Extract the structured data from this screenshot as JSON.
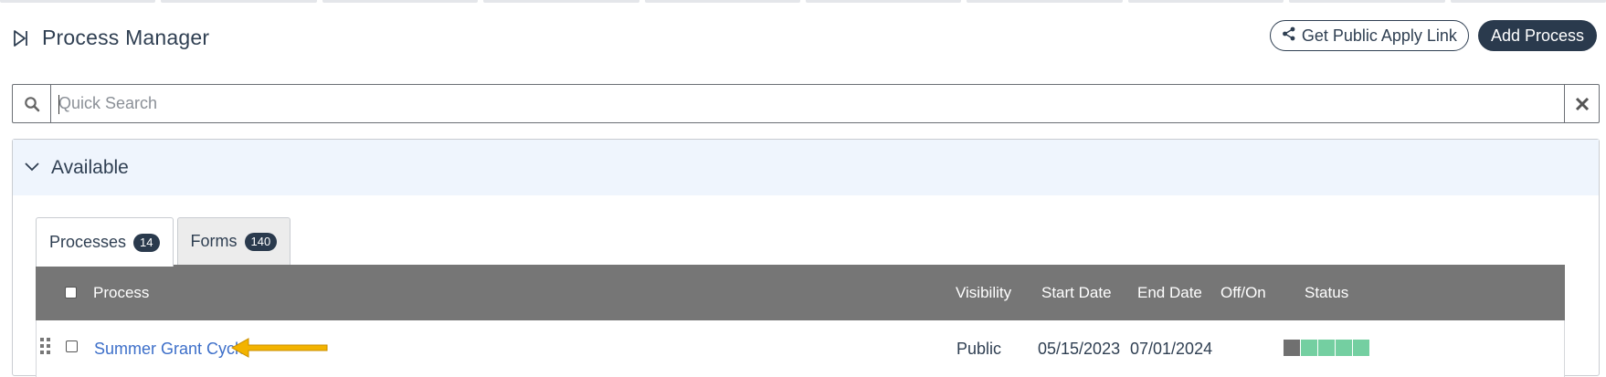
{
  "header": {
    "title": "Process Manager",
    "public_link_label": "Get Public Apply Link",
    "add_process_label": "Add Process"
  },
  "search": {
    "placeholder": "Quick Search",
    "value": ""
  },
  "panel": {
    "title": "Available",
    "tabs": [
      {
        "label": "Processes",
        "count": "14",
        "active": true
      },
      {
        "label": "Forms",
        "count": "140",
        "active": false
      }
    ]
  },
  "grid": {
    "columns": {
      "process": "Process",
      "visibility": "Visibility",
      "start_date": "Start Date",
      "end_date": "End Date",
      "off_on": "Off/On",
      "status": "Status"
    },
    "rows": [
      {
        "process": "Summer Grant Cycle",
        "visibility": "Public",
        "start_date": "05/15/2023",
        "end_date": "07/01/2024",
        "enabled": false,
        "status_segments": [
          "gray",
          "green",
          "green",
          "green",
          "green"
        ]
      }
    ]
  },
  "annotation": {
    "arrow_color": "#f3b300"
  },
  "colors": {
    "primary": "#2a3a4d",
    "link": "#3d6fc9",
    "panel_header_bg": "#eff5fd",
    "grid_header_bg": "#767676",
    "status_gray": "#707070",
    "status_green": "#74cfa1"
  }
}
